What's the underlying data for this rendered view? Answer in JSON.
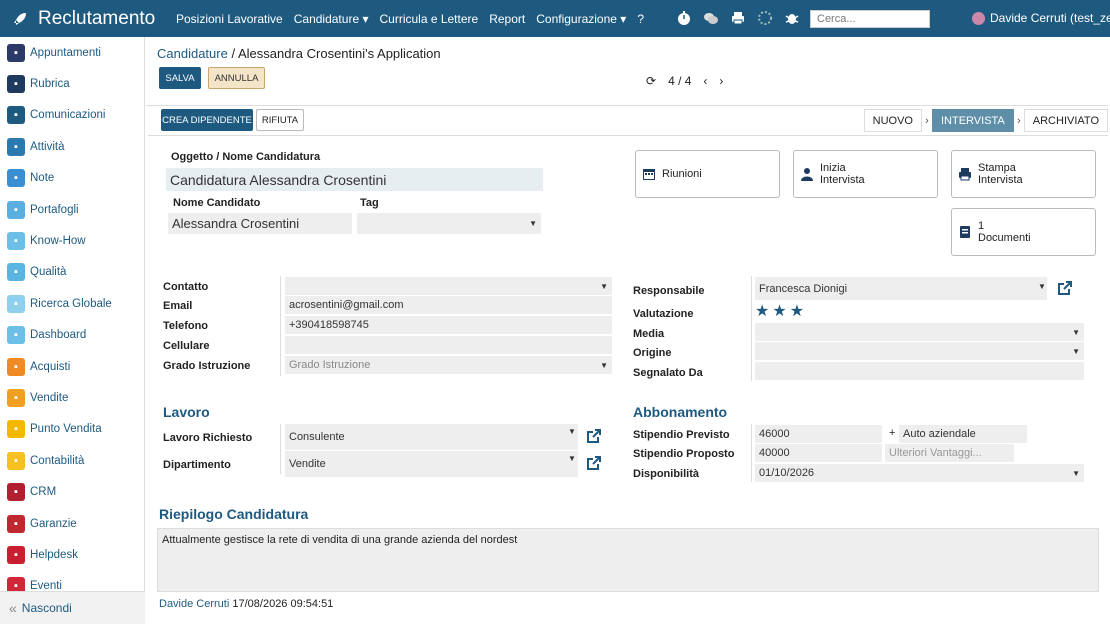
{
  "app": {
    "title": "Reclutamento"
  },
  "menu": [
    "Posizioni Lavorative",
    "Candidature ▾",
    "Curricula e Lettere",
    "Report",
    "Configurazione ▾",
    "?"
  ],
  "search": {
    "placeholder": "Cerca..."
  },
  "user": {
    "name": "Davide Cerruti (test_zelo)"
  },
  "sidebar": [
    {
      "label": "Appuntamenti",
      "icon": "calendar-icon",
      "color": "#2b3a67"
    },
    {
      "label": "Rubrica",
      "icon": "contacts-icon",
      "color": "#1e3a5f"
    },
    {
      "label": "Comunicazioni",
      "icon": "chat-icon",
      "color": "#1e5a80"
    },
    {
      "label": "Attività",
      "icon": "check-icon",
      "color": "#2a7ab0"
    },
    {
      "label": "Note",
      "icon": "note-icon",
      "color": "#3a8fd0"
    },
    {
      "label": "Portafogli",
      "icon": "wallet-icon",
      "color": "#5aaee0"
    },
    {
      "label": "Know-How",
      "icon": "brain-icon",
      "color": "#6cc0e8"
    },
    {
      "label": "Qualità",
      "icon": "quality-icon",
      "color": "#5ab6e0"
    },
    {
      "label": "Ricerca Globale",
      "icon": "search-icon",
      "color": "#8fd0ef"
    },
    {
      "label": "Dashboard",
      "icon": "dashboard-icon",
      "color": "#6cc0e8"
    },
    {
      "label": "Acquisti",
      "icon": "purchase-icon",
      "color": "#f08a24"
    },
    {
      "label": "Vendite",
      "icon": "sales-icon",
      "color": "#f0a020"
    },
    {
      "label": "Punto Vendita",
      "icon": "pos-icon",
      "color": "#f5b800"
    },
    {
      "label": "Contabilità",
      "icon": "accounting-icon",
      "color": "#f5c020"
    },
    {
      "label": "CRM",
      "icon": "handshake-icon",
      "color": "#b02030"
    },
    {
      "label": "Garanzie",
      "icon": "shield-icon",
      "color": "#c02830"
    },
    {
      "label": "Helpdesk",
      "icon": "headset-icon",
      "color": "#c81e30"
    },
    {
      "label": "Eventi",
      "icon": "event-icon",
      "color": "#d02838"
    }
  ],
  "sidebar_hide": "Nascondi",
  "breadcrumb": {
    "parent": "Candidature",
    "sep": "/",
    "current": "Alessandra Crosentini's Application"
  },
  "actions": {
    "save": "SALVA",
    "cancel": "ANNULLA",
    "create_employee": "CREA DIPENDENTE",
    "refuse": "RIFIUTA"
  },
  "pager": {
    "text": "4 / 4"
  },
  "stages": [
    "NUOVO",
    "INTERVISTA",
    "ARCHIVIATO"
  ],
  "smart_buttons": {
    "meetings": "Riunioni",
    "interview_1": "Inizia",
    "interview_2": "Intervista",
    "print_1": "Stampa",
    "print_2": "Intervista",
    "docs_count": "1",
    "docs_label": "Documenti"
  },
  "form": {
    "subject_label": "Oggetto / Nome Candidatura",
    "subject": "Candidatura Alessandra Crosentini",
    "name_label": "Nome Candidato",
    "name": "Alessandra Crosentini",
    "tag_label": "Tag",
    "contact_label": "Contatto",
    "email_label": "Email",
    "email": "acrosentini@gmail.com",
    "phone_label": "Telefono",
    "phone": "+390418598745",
    "mobile_label": "Cellulare",
    "degree_label": "Grado Istruzione",
    "degree_placeholder": "Grado Istruzione",
    "responsible_label": "Responsabile",
    "responsible": "Francesca Dionigi",
    "rating_label": "Valutazione",
    "rating": 3,
    "media_label": "Media",
    "origin_label": "Origine",
    "referred_label": "Segnalato Da",
    "job_section": "Lavoro",
    "job_label": "Lavoro Richiesto",
    "job": "Consulente",
    "department_label": "Dipartimento",
    "department": "Vendite",
    "contract_section": "Abbonamento",
    "expected_label": "Stipendio Previsto",
    "expected": "46000",
    "plus": "+",
    "expected_extra": "Auto aziendale",
    "proposed_label": "Stipendio Proposto",
    "proposed": "40000",
    "proposed_extra_placeholder": "Ulteriori Vantaggi...",
    "availability_label": "Disponibilità",
    "availability": "01/10/2026",
    "summary_section": "Riepilogo Candidatura",
    "summary": "Attualmente gestisce la rete di vendita di una grande azienda del nordest"
  },
  "footer": {
    "author": "Davide Cerruti",
    "date": "17/08/2026 09:54:51"
  }
}
